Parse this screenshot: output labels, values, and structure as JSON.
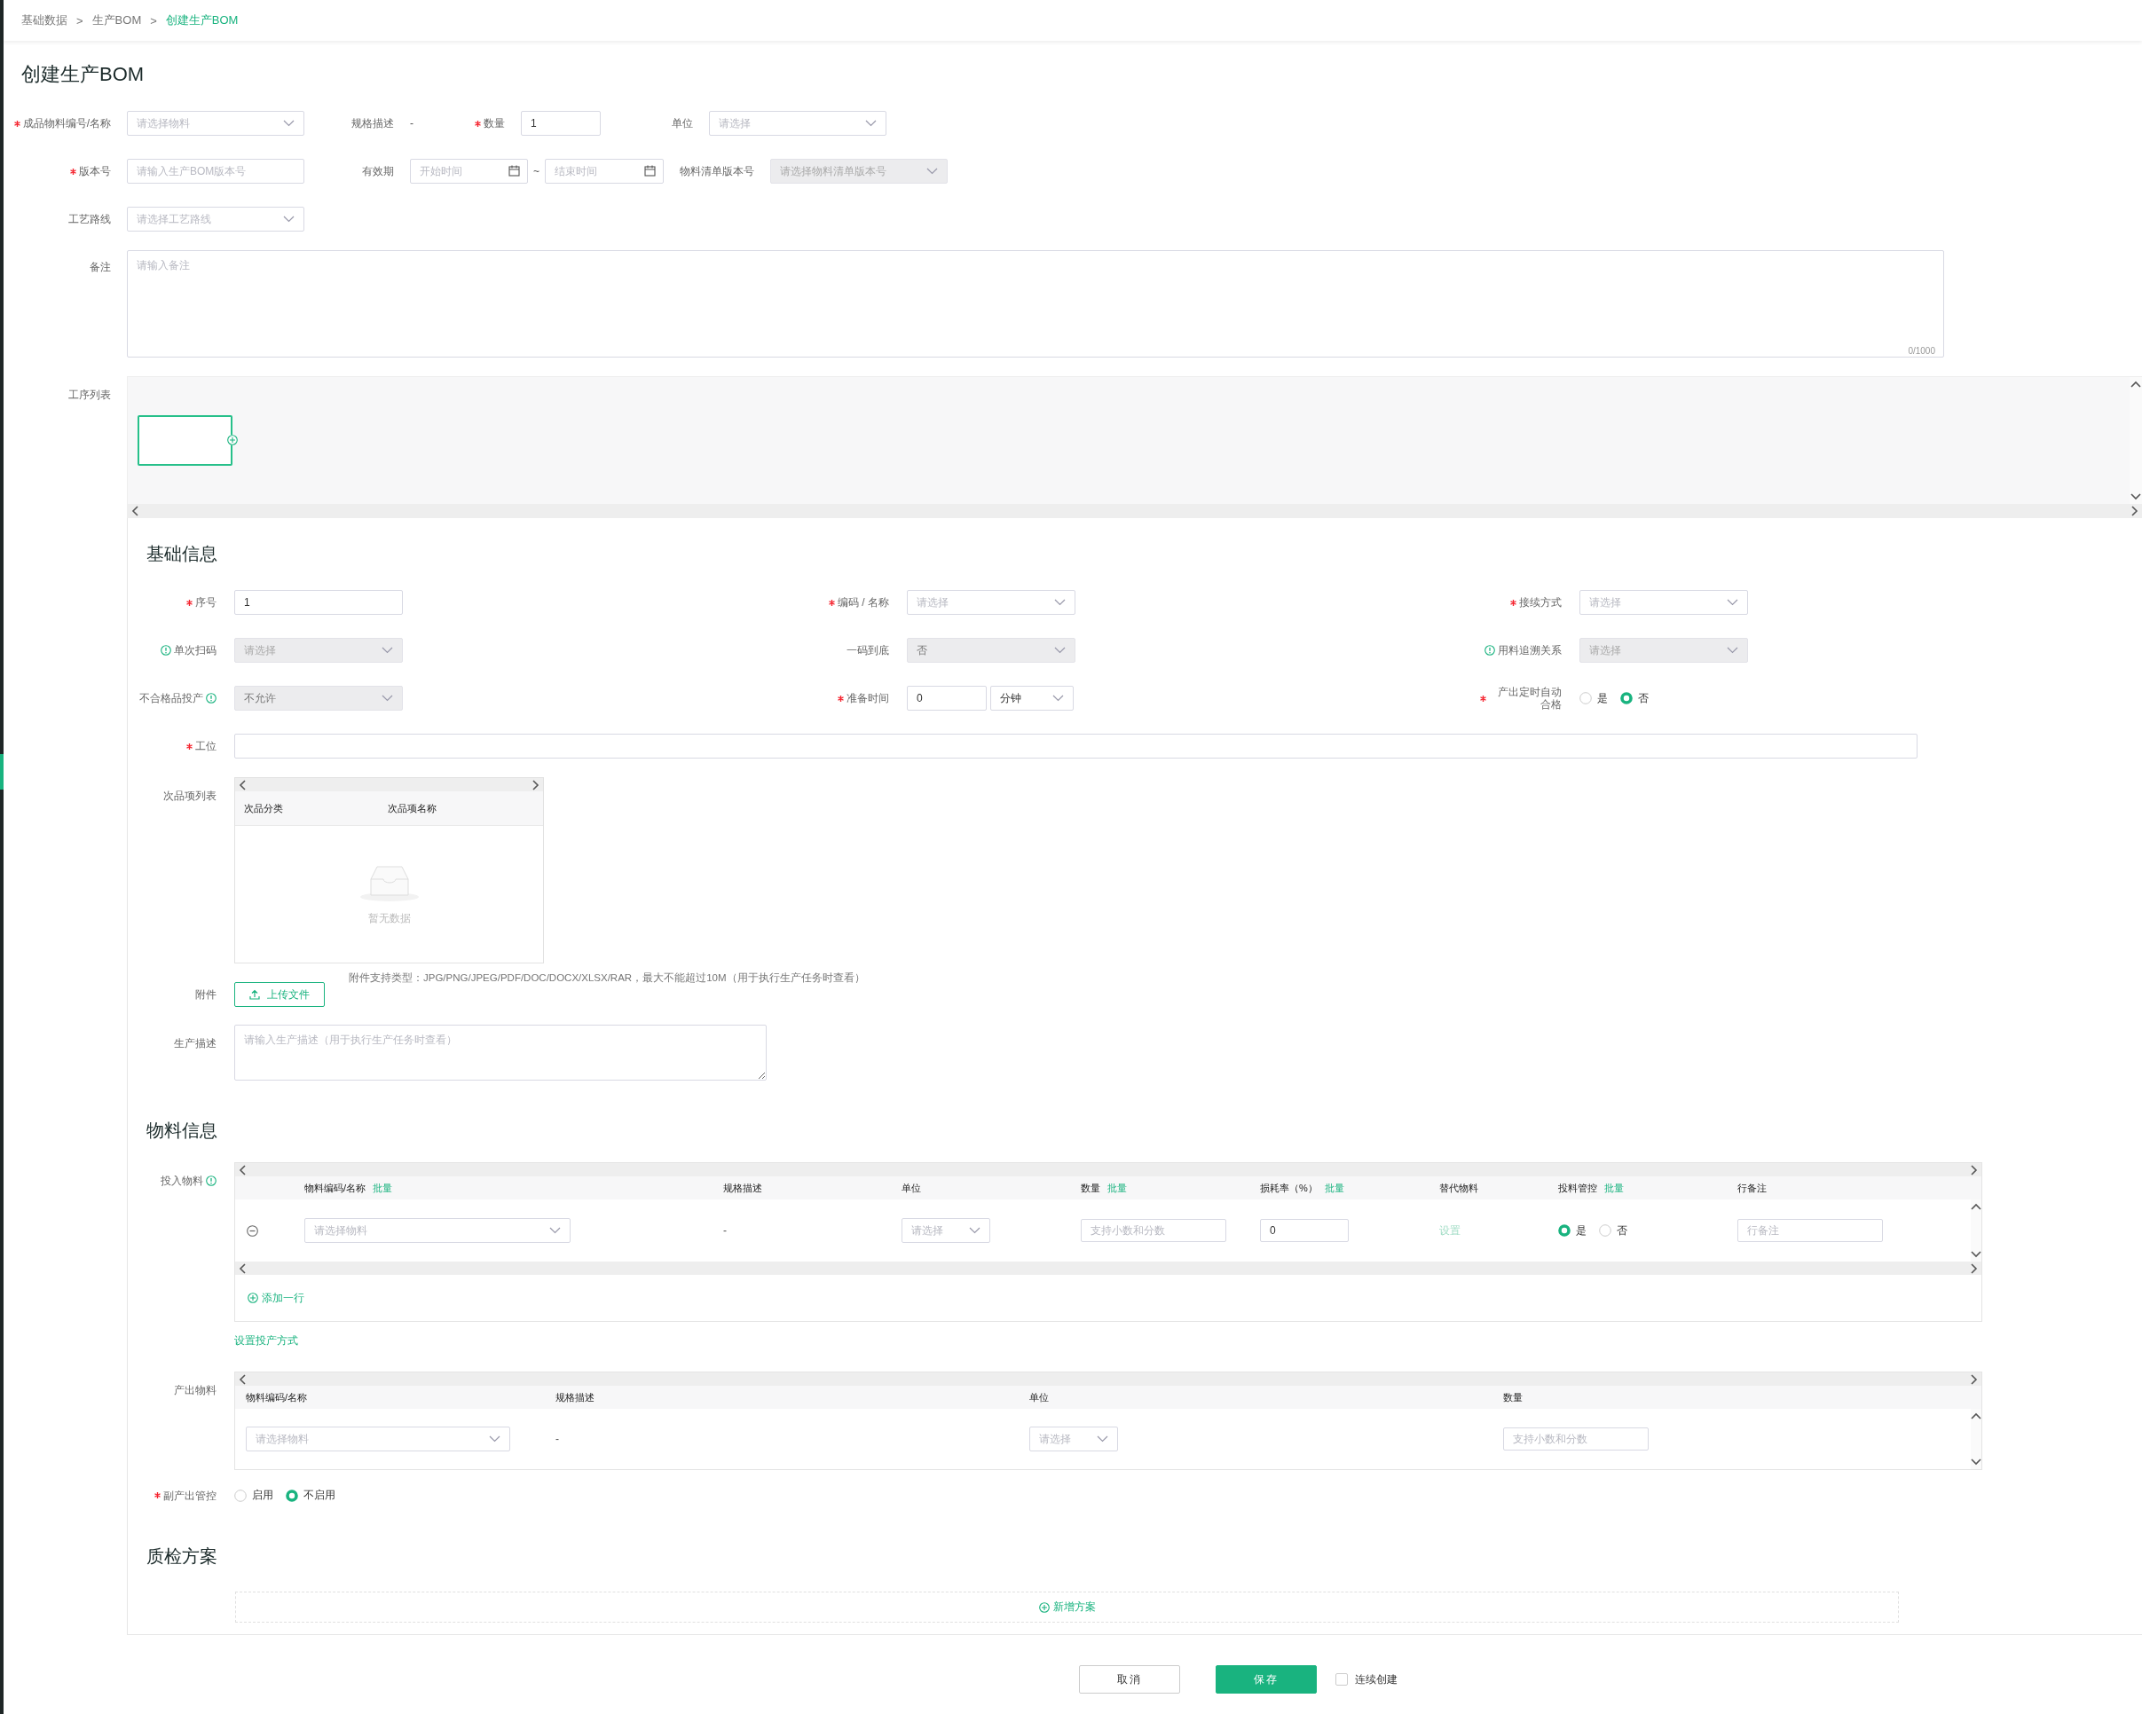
{
  "breadcrumb": {
    "items": [
      {
        "label": "基础数据",
        "selected": false
      },
      {
        "label": "生产BOM",
        "selected": false
      },
      {
        "label": "创建生产BOM",
        "selected": true
      }
    ],
    "separators": [
      ">",
      ">"
    ]
  },
  "title": "创建生产BOM",
  "header": {
    "rows": [
      {
        "fields": [
          {
            "kind": "select",
            "label": "成品物料编号/名称",
            "required": true,
            "placeholder": "请选择物料",
            "disabled": false
          },
          {
            "kind": "text",
            "label": "规格描述",
            "required": false,
            "value": "-"
          },
          {
            "kind": "input",
            "label": "数量",
            "required": true,
            "value": "1"
          },
          {
            "kind": "select",
            "label": "单位",
            "required": false,
            "placeholder": "请选择",
            "disabled": false
          }
        ]
      },
      {
        "fields": [
          {
            "kind": "input",
            "label": "版本号",
            "required": true,
            "placeholder": "请输入生产BOM版本号"
          },
          {
            "kind": "daterange",
            "label": "有效期",
            "required": false,
            "start_placeholder": "开始时间",
            "separator": "~",
            "end_placeholder": "结束时间"
          },
          {
            "kind": "select",
            "label": "物料清单版本号",
            "required": false,
            "placeholder": "请选择物料清单版本号",
            "disabled": true
          }
        ]
      },
      {
        "fields": [
          {
            "kind": "select",
            "label": "工艺路线",
            "required": false,
            "placeholder": "请选择工艺路线",
            "disabled": false
          }
        ]
      }
    ]
  },
  "remark": {
    "label": "备注",
    "placeholder": "请输入备注",
    "counter": "0/1000"
  },
  "process_list": {
    "label": "工序列表"
  },
  "basic_info": {
    "title": "基础信息",
    "fields": [
      {
        "kind": "input",
        "label": "序号",
        "required": true,
        "value": "1"
      },
      {
        "kind": "select",
        "label": "编码 / 名称",
        "required": true,
        "placeholder": "请选择",
        "disabled": false
      },
      {
        "kind": "select",
        "label": "接续方式",
        "required": true,
        "placeholder": "请选择",
        "disabled": false
      },
      {
        "kind": "select",
        "label": "单次扫码",
        "required": false,
        "info_icon_before": true,
        "placeholder": "请选择",
        "disabled": true
      },
      {
        "kind": "select",
        "label": "一码到底",
        "required": false,
        "value": "否",
        "disabled": true
      },
      {
        "kind": "select",
        "label": "用料追溯关系",
        "required": false,
        "info_icon_before": true,
        "placeholder": "请选择",
        "disabled": true
      },
      {
        "kind": "select",
        "label": "不合格品投产",
        "required": false,
        "info_icon_after": true,
        "value": "不允许",
        "disabled": true
      },
      {
        "kind": "duration",
        "label": "准备时间",
        "required": true,
        "value": "0",
        "unit": "分钟"
      },
      {
        "kind": "radio",
        "label": "产出定时自动合格",
        "required": true,
        "options": [
          {
            "label": "是",
            "selected": false
          },
          {
            "label": "否",
            "selected": true
          }
        ]
      }
    ],
    "workstation": {
      "kind": "input",
      "label": "工位",
      "required": true
    },
    "defects": {
      "label": "次品项列表",
      "columns": [
        "次品分类",
        "次品项名称"
      ],
      "empty_text": "暂无数据"
    },
    "attachment": {
      "label": "附件",
      "button": "上传文件",
      "hint": "附件支持类型：JPG/PNG/JPEG/PDF/DOC/DOCX/XLSX/RAR，最大不能超过10M（用于执行生产任务时查看）"
    },
    "production_description": {
      "label": "生产描述",
      "placeholder": "请输入生产描述（用于执行生产任务时查看）"
    }
  },
  "material_info": {
    "title": "物料信息",
    "input_materials": {
      "label": "投入物料",
      "info_icon_after": true,
      "columns": [
        {
          "label": "物料编码/名称",
          "batch": "批量"
        },
        {
          "label": "规格描述"
        },
        {
          "label": "单位"
        },
        {
          "label": "数量",
          "batch": "批量"
        },
        {
          "label": "损耗率（%）",
          "batch": "批量"
        },
        {
          "label": "替代物料"
        },
        {
          "label": "投料管控",
          "batch": "批量"
        },
        {
          "label": "行备注"
        }
      ],
      "rows": [
        {
          "removable": true,
          "cells": [
            {
              "kind": "select",
              "placeholder": "请选择物料"
            },
            {
              "kind": "text",
              "value": "-"
            },
            {
              "kind": "select",
              "placeholder": "请选择"
            },
            {
              "kind": "input",
              "placeholder": "支持小数和分数"
            },
            {
              "kind": "input",
              "value": "0"
            },
            {
              "kind": "link",
              "text": "设置",
              "disabled": true
            },
            {
              "kind": "radio",
              "options": [
                {
                  "label": "是",
                  "selected": true
                },
                {
                  "label": "否",
                  "selected": false
                }
              ]
            },
            {
              "kind": "input",
              "placeholder": "行备注"
            }
          ]
        }
      ],
      "add_row": "添加一行"
    },
    "set_mode_link": "设置投产方式",
    "output_materials": {
      "label": "产出物料",
      "columns": [
        {
          "label": "物料编码/名称"
        },
        {
          "label": "规格描述"
        },
        {
          "label": "单位"
        },
        {
          "label": "数量"
        }
      ],
      "rows": [
        {
          "cells": [
            {
              "kind": "select",
              "placeholder": "请选择物料"
            },
            {
              "kind": "text",
              "value": "-"
            },
            {
              "kind": "select",
              "placeholder": "请选择"
            },
            {
              "kind": "input",
              "placeholder": "支持小数和分数"
            }
          ]
        }
      ]
    },
    "byproduct_control": {
      "label": "副产出管控",
      "required": true,
      "options": [
        {
          "label": "启用",
          "selected": false
        },
        {
          "label": "不启用",
          "selected": true
        }
      ]
    }
  },
  "quality": {
    "title": "质检方案",
    "add_link": "新增方案"
  },
  "footer": {
    "buttons": [
      {
        "label": "取消",
        "kind": "secondary"
      },
      {
        "label": "保存",
        "kind": "primary"
      }
    ],
    "continuous_create": {
      "label": "连续创建",
      "checked": false
    }
  }
}
